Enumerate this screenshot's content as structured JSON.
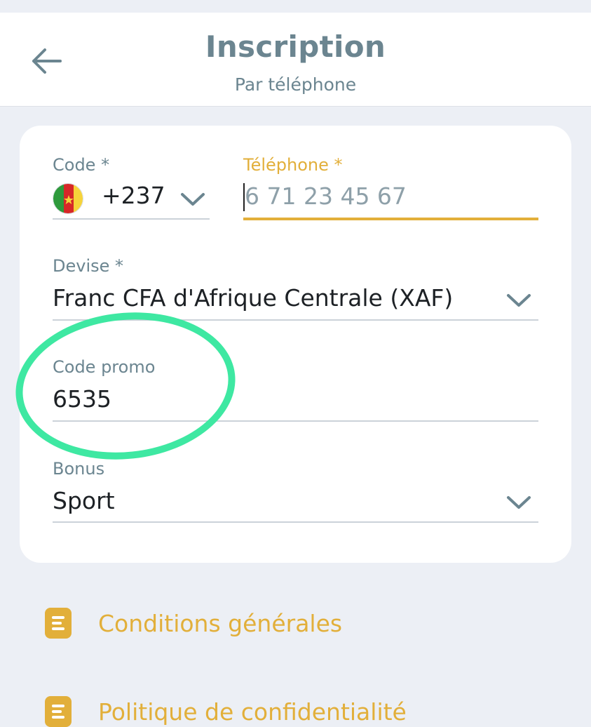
{
  "header": {
    "title": "Inscription",
    "subtitle": "Par téléphone",
    "back_icon": "arrow-left-icon"
  },
  "form": {
    "code": {
      "label": "Code *",
      "value": "+237",
      "flag_icon": "cameroon-flag-icon"
    },
    "telephone": {
      "label": "Téléphone *",
      "placeholder": "6 71 23 45 67",
      "value": ""
    },
    "devise": {
      "label": "Devise *",
      "value": "Franc CFA d'Afrique Centrale (XAF)"
    },
    "promo": {
      "label": "Code promo",
      "value": "6535"
    },
    "bonus": {
      "label": "Bonus",
      "value": "Sport"
    }
  },
  "links": [
    {
      "label": "Conditions générales",
      "icon": "document-icon"
    },
    {
      "label": "Politique de confidentialité",
      "icon": "document-icon"
    }
  ],
  "colors": {
    "accent": "#e2af3a",
    "muted_text": "#6b8590",
    "background": "#eceff5",
    "annotation_ring": "#3ee8a2"
  }
}
